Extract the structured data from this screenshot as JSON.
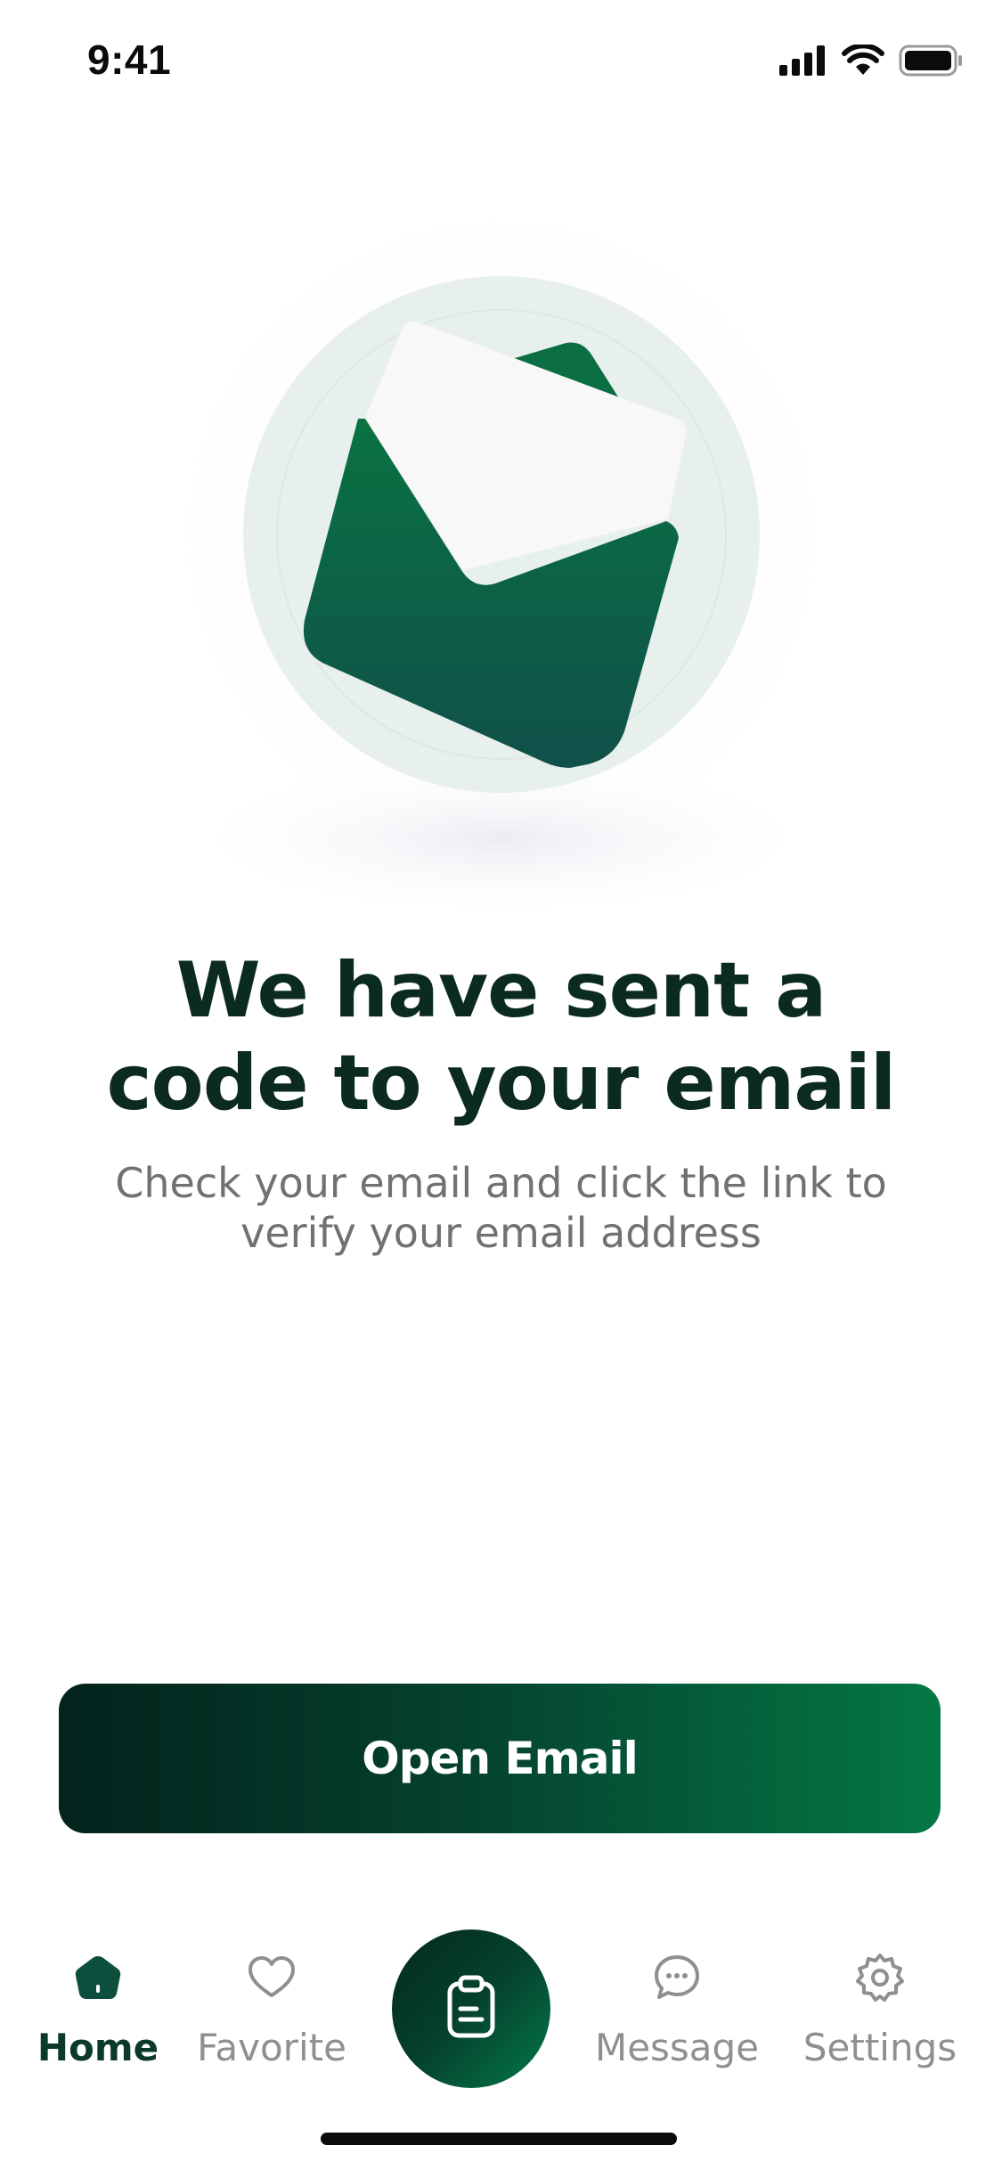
{
  "status_bar": {
    "time": "9:41",
    "icons": [
      "cellular-signal-icon",
      "wifi-icon",
      "battery-icon"
    ]
  },
  "illustration": {
    "icon": "open-envelope-icon",
    "colors": {
      "circle": "#e8f0ee",
      "envelope_top": "#0b6f43",
      "envelope_bottom": "#0f5145",
      "letter": "#f9f9f9"
    }
  },
  "content": {
    "headline_line1": "We have sent a",
    "headline_line2": "code to your email",
    "subtitle_line1": "Check your email and click the link to",
    "subtitle_line2": "verify your email address"
  },
  "actions": {
    "open_email_label": "Open Email"
  },
  "tab_bar": {
    "items": [
      {
        "label": "Home",
        "icon": "home-icon",
        "active": true
      },
      {
        "label": "Favorite",
        "icon": "heart-icon",
        "active": false
      },
      {
        "label": "Message",
        "icon": "chat-bubble-icon",
        "active": false
      },
      {
        "label": "Settings",
        "icon": "gear-icon",
        "active": false
      }
    ],
    "center_button_icon": "clipboard-icon"
  },
  "colors": {
    "brand_dark": "#03231c",
    "brand_green": "#047844",
    "headline": "#0b2a22",
    "muted_text": "#6f7173",
    "tab_inactive": "#8d8f91"
  }
}
